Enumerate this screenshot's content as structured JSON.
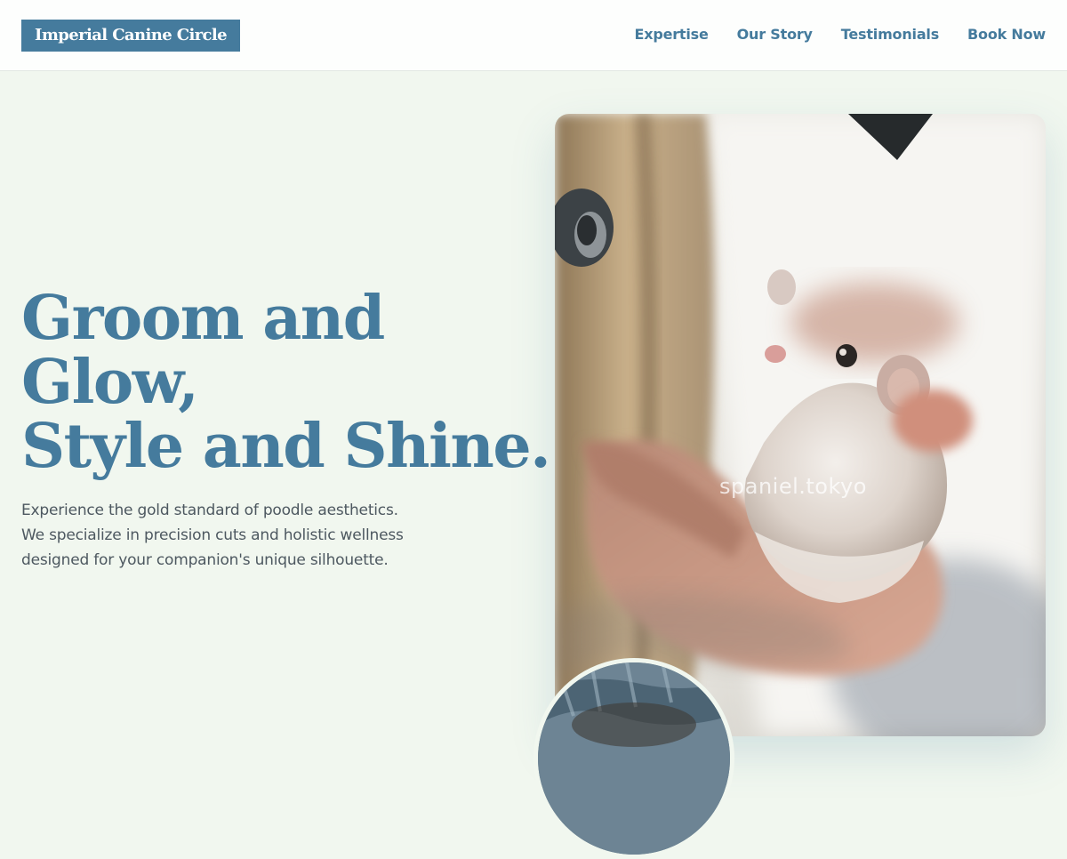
{
  "header": {
    "logo": "Imperial Canine Circle",
    "nav": [
      {
        "label": "Expertise"
      },
      {
        "label": "Our Story"
      },
      {
        "label": "Testimonials"
      },
      {
        "label": "Book Now"
      }
    ]
  },
  "hero": {
    "title_lines": [
      "Groom and",
      "Glow,",
      "Style and Shine."
    ],
    "description": "Experience the gold standard of poodle aesthetics. We specialize in precision cuts and holistic wellness designed for your companion's unique silhouette."
  },
  "photo": {
    "watermark": "spaniel.tokyo"
  },
  "colors": {
    "brand": "#457b9d",
    "background": "#f1f7ef",
    "header_bg": "#fdfefd",
    "body_text": "#4d5860"
  }
}
